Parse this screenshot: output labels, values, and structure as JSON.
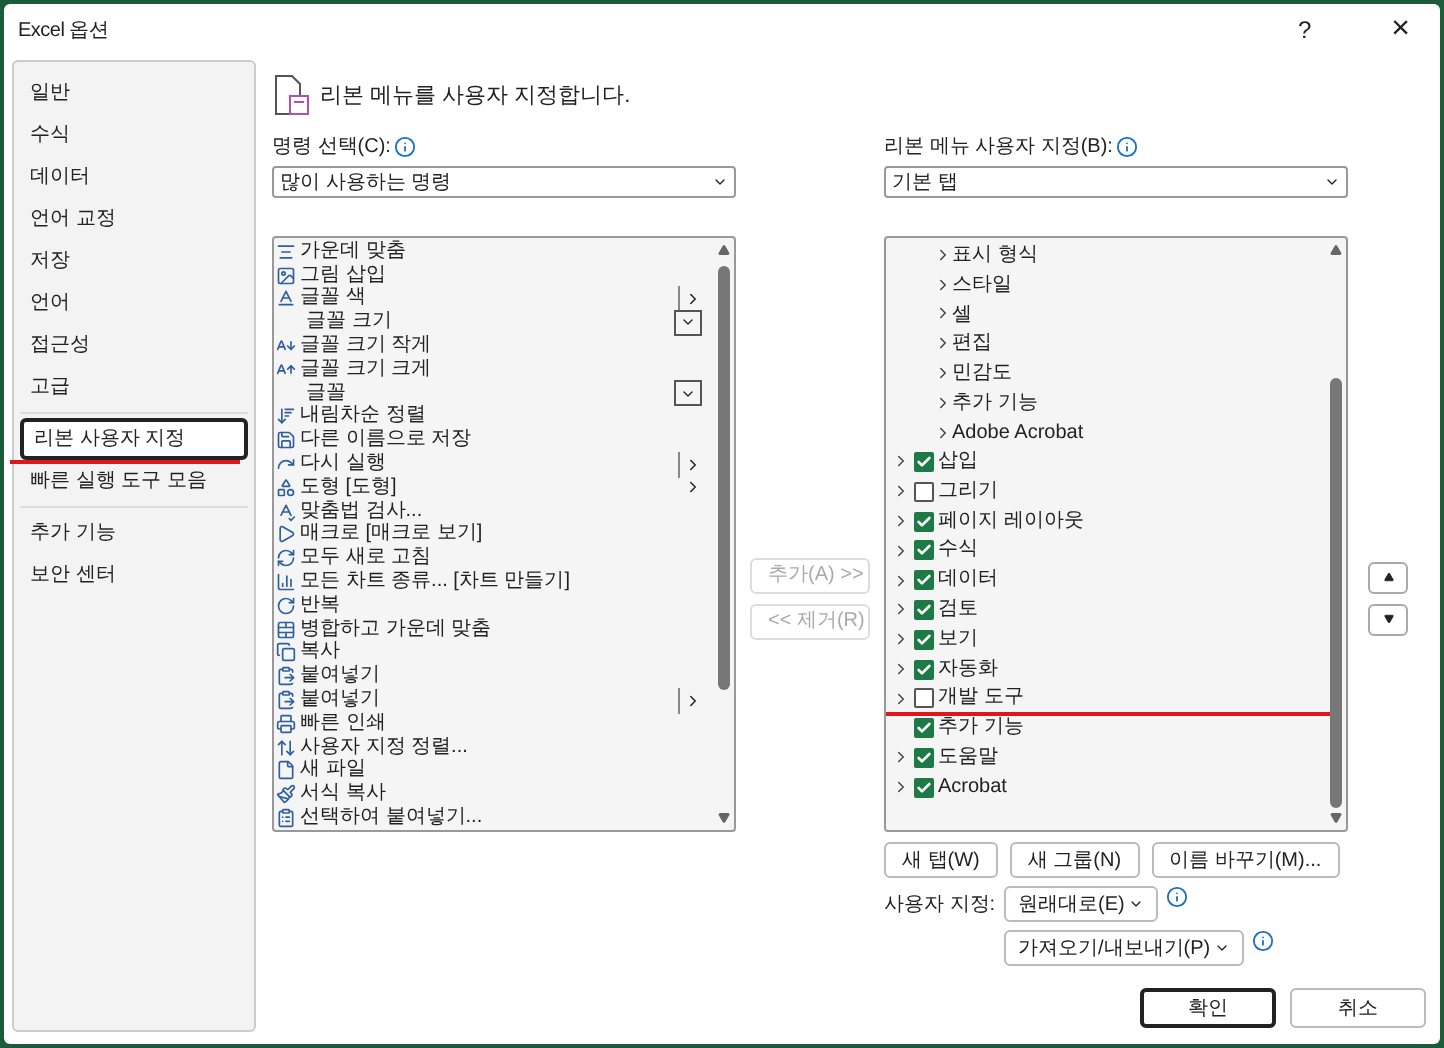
{
  "window": {
    "title": "Excel 옵션",
    "help": "?",
    "close": "×"
  },
  "sidebar": {
    "sections": [
      [
        {
          "label": "일반",
          "selected": false
        },
        {
          "label": "수식",
          "selected": false
        },
        {
          "label": "데이터",
          "selected": false
        },
        {
          "label": "언어 교정",
          "selected": false
        },
        {
          "label": "저장",
          "selected": false
        },
        {
          "label": "언어",
          "selected": false
        },
        {
          "label": "접근성",
          "selected": false
        },
        {
          "label": "고급",
          "selected": false
        }
      ],
      [
        {
          "label": "리본 사용자 지정",
          "selected": true
        },
        {
          "label": "빠른 실행 도구 모음",
          "selected": false
        }
      ],
      [
        {
          "label": "추가 기능",
          "selected": false
        },
        {
          "label": "보안 센터",
          "selected": false
        }
      ]
    ]
  },
  "heading": "리본 메뉴를 사용자 지정합니다.",
  "commands": {
    "label": "명령 선택(C):",
    "dropdown": "많이 사용하는 명령",
    "items": [
      {
        "label": "가운데 맞춤",
        "icon": true,
        "kind": "plain"
      },
      {
        "label": "그림 삽입",
        "icon": true,
        "kind": "plain"
      },
      {
        "label": "글꼴 색",
        "icon": true,
        "kind": "submenu"
      },
      {
        "label": "글꼴 크기",
        "icon": false,
        "kind": "field"
      },
      {
        "label": "글꼴 크기 작게",
        "icon": true,
        "kind": "plain"
      },
      {
        "label": "글꼴 크기 크게",
        "icon": true,
        "kind": "plain"
      },
      {
        "label": "글꼴",
        "icon": false,
        "kind": "field"
      },
      {
        "label": "내림차순 정렬",
        "icon": true,
        "kind": "plain"
      },
      {
        "label": "다른 이름으로 저장",
        "icon": true,
        "kind": "plain"
      },
      {
        "label": "다시 실행",
        "icon": true,
        "kind": "submenu"
      },
      {
        "label": "도형 [도형]",
        "icon": true,
        "kind": "arrow"
      },
      {
        "label": "맞춤법 검사...",
        "icon": true,
        "kind": "plain"
      },
      {
        "label": "매크로 [매크로 보기]",
        "icon": true,
        "kind": "plain"
      },
      {
        "label": "모두 새로 고침",
        "icon": true,
        "kind": "plain"
      },
      {
        "label": "모든 차트 종류... [차트 만들기]",
        "icon": true,
        "kind": "plain"
      },
      {
        "label": "반복",
        "icon": true,
        "kind": "plain"
      },
      {
        "label": "병합하고 가운데 맞춤",
        "icon": true,
        "kind": "plain"
      },
      {
        "label": "복사",
        "icon": true,
        "kind": "plain"
      },
      {
        "label": "붙여넣기",
        "icon": true,
        "kind": "plain"
      },
      {
        "label": "붙여넣기",
        "icon": true,
        "kind": "submenu"
      },
      {
        "label": "빠른 인쇄",
        "icon": true,
        "kind": "plain"
      },
      {
        "label": "사용자 지정 정렬...",
        "icon": true,
        "kind": "plain"
      },
      {
        "label": "새 파일",
        "icon": true,
        "kind": "plain"
      },
      {
        "label": "서식 복사",
        "icon": true,
        "kind": "plain"
      },
      {
        "label": "선택하여 붙여넣기...",
        "icon": true,
        "kind": "plain"
      }
    ]
  },
  "add_button": {
    "label": "추가(A) >>",
    "disabled": true
  },
  "remove_button": {
    "label": "<< 제거(R)",
    "disabled": true
  },
  "ribbon": {
    "label": "리본 메뉴 사용자 지정(B):",
    "dropdown": "기본 탭",
    "scrolled_tab_groups": [
      {
        "label": "표시 형식"
      },
      {
        "label": "스타일"
      },
      {
        "label": "셀"
      },
      {
        "label": "편집"
      },
      {
        "label": "민감도"
      },
      {
        "label": "추가 기능"
      },
      {
        "label": "Adobe Acrobat"
      }
    ],
    "tabs": [
      {
        "label": "삽입",
        "checked": true,
        "expandable": true
      },
      {
        "label": "그리기",
        "checked": false,
        "expandable": true
      },
      {
        "label": "페이지 레이아웃",
        "checked": true,
        "expandable": true
      },
      {
        "label": "수식",
        "checked": true,
        "expandable": true
      },
      {
        "label": "데이터",
        "checked": true,
        "expandable": true
      },
      {
        "label": "검토",
        "checked": true,
        "expandable": true
      },
      {
        "label": "보기",
        "checked": true,
        "expandable": true
      },
      {
        "label": "자동화",
        "checked": true,
        "expandable": true
      },
      {
        "label": "개발 도구",
        "checked": false,
        "expandable": true
      },
      {
        "label": "추가 기능",
        "checked": true,
        "expandable": false
      },
      {
        "label": "도움말",
        "checked": true,
        "expandable": true
      },
      {
        "label": "Acrobat",
        "checked": true,
        "expandable": true
      }
    ],
    "buttons": [
      "새 탭(W)",
      "새 그룹(N)",
      "이름 바꾸기(M)..."
    ],
    "customize_label": "사용자 지정:",
    "reset_button": "원래대로(E)",
    "import_export_button": "가져오기/내보내기(P)"
  },
  "footer_buttons": [
    {
      "label": "확인",
      "default": true
    },
    {
      "label": "취소",
      "default": false
    }
  ]
}
